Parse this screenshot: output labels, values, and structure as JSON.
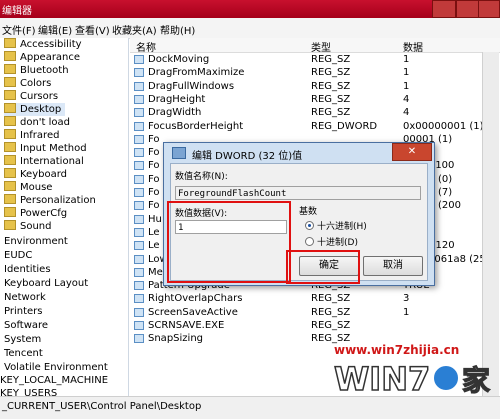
{
  "window": {
    "title": "编辑器"
  },
  "menu": [
    "文件(F)",
    "编辑(E)",
    "查看(V)",
    "收藏夹(A)",
    "帮助(H)"
  ],
  "tree": {
    "items": [
      "Accessibility",
      "Appearance",
      "Bluetooth",
      "Colors",
      "Cursors",
      "Desktop",
      "don't load",
      "Infrared",
      "Input Method",
      "International",
      "Keyboard",
      "Mouse",
      "Personalization",
      "PowerCfg",
      "Sound"
    ],
    "selected": "Desktop",
    "roots": [
      "Environment",
      "EUDC",
      "Identities",
      "Keyboard Layout",
      "Network",
      "Printers",
      "Software",
      "System",
      "Tencent",
      "Volatile Environment"
    ],
    "hives": [
      "KEY_LOCAL_MACHINE",
      "KEY_USERS"
    ]
  },
  "columns": {
    "name": "名称",
    "type": "类型",
    "data": "数据"
  },
  "rows": [
    {
      "name": "DockMoving",
      "type": "REG_SZ",
      "data": "1"
    },
    {
      "name": "DragFromMaximize",
      "type": "REG_SZ",
      "data": "1"
    },
    {
      "name": "DragFullWindows",
      "type": "REG_SZ",
      "data": "1"
    },
    {
      "name": "DragHeight",
      "type": "REG_SZ",
      "data": "4"
    },
    {
      "name": "DragWidth",
      "type": "REG_SZ",
      "data": "4"
    },
    {
      "name": "FocusBorderHeight",
      "type": "REG_DWORD",
      "data": "0x00000001 (1)"
    },
    {
      "name": "Fo",
      "type": "",
      "data": "00001 (1)"
    },
    {
      "name": "Fo",
      "type": "",
      "data": ""
    },
    {
      "name": "Fo",
      "type": "",
      "data": "03e8 (100"
    },
    {
      "name": "Fo",
      "type": "",
      "data": "00000 (0)"
    },
    {
      "name": "Fo",
      "type": "",
      "data": "00007 (7)"
    },
    {
      "name": "Fo",
      "type": "",
      "data": "00d40 (200"
    },
    {
      "name": "Hu",
      "type": "",
      "data": ""
    },
    {
      "name": "Le",
      "type": "",
      "data": ""
    },
    {
      "name": "Le",
      "type": "",
      "data": "0078 (120"
    },
    {
      "name": "LowLevelHooksTimeout",
      "type": "REG_DWORD",
      "data": "0x000061a8 (250"
    },
    {
      "name": "MenuShowDelay",
      "type": "REG_SZ",
      "data": "0"
    },
    {
      "name": "Pattern Upgrade",
      "type": "REG_SZ",
      "data": "TRUE"
    },
    {
      "name": "RightOverlapChars",
      "type": "REG_SZ",
      "data": "3"
    },
    {
      "name": "ScreenSaveActive",
      "type": "REG_SZ",
      "data": "1"
    },
    {
      "name": "SCRNSAVE.EXE",
      "type": "REG_SZ",
      "data": ""
    },
    {
      "name": "SnapSizing",
      "type": "REG_SZ",
      "data": ""
    }
  ],
  "statusbar": {
    "path": "_CURRENT_USER\\Control Panel\\Desktop"
  },
  "dialog": {
    "title": "编辑 DWORD (32 位)值",
    "close_label": "✕",
    "value_name_label": "数值名称(N):",
    "value_name": "ForegroundFlashCount",
    "value_data_label": "数值数据(V):",
    "value_data": "1",
    "base_label": "基数",
    "hex_label": "十六进制(H)",
    "dec_label": "十进制(D)",
    "ok_label": "确定",
    "cancel_label": "取消"
  },
  "watermark": {
    "url": "www.win7zhijia.cn",
    "brand": "WIN7",
    "suffix": "家"
  }
}
